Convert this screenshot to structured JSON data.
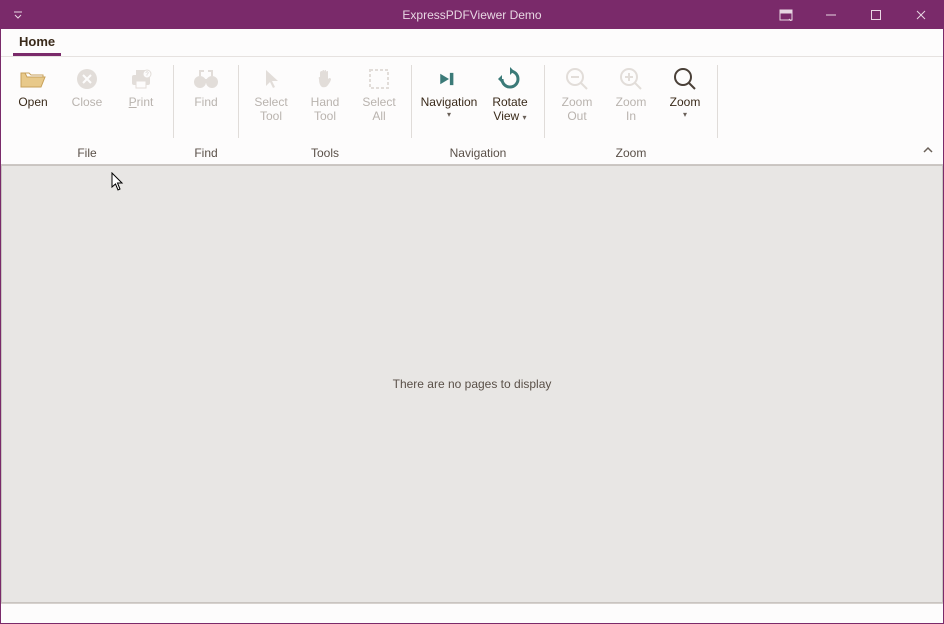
{
  "titlebar": {
    "title": "ExpressPDFViewer Demo"
  },
  "tabs": {
    "home": "Home"
  },
  "ribbon": {
    "file": {
      "label": "File",
      "open": "Open",
      "close": "Close",
      "print": "Print"
    },
    "find": {
      "label": "Find",
      "find": "Find"
    },
    "tools": {
      "label": "Tools",
      "select_tool_l1": "Select",
      "select_tool_l2": "Tool",
      "hand_tool_l1": "Hand",
      "hand_tool_l2": "Tool",
      "select_all_l1": "Select",
      "select_all_l2": "All"
    },
    "navigation": {
      "label": "Navigation",
      "navigation": "Navigation",
      "rotate_l1": "Rotate",
      "rotate_l2": "View"
    },
    "zoom": {
      "label": "Zoom",
      "zoom_out_l1": "Zoom",
      "zoom_out_l2": "Out",
      "zoom_in_l1": "Zoom",
      "zoom_in_l2": "In",
      "zoom": "Zoom"
    }
  },
  "content": {
    "empty_message": "There are no pages to display"
  },
  "colors": {
    "accent": "#7a2a6a",
    "disabled": "#b9b3ae",
    "icon_active": "#3b7a78",
    "icon_open": "#c8a15a"
  }
}
